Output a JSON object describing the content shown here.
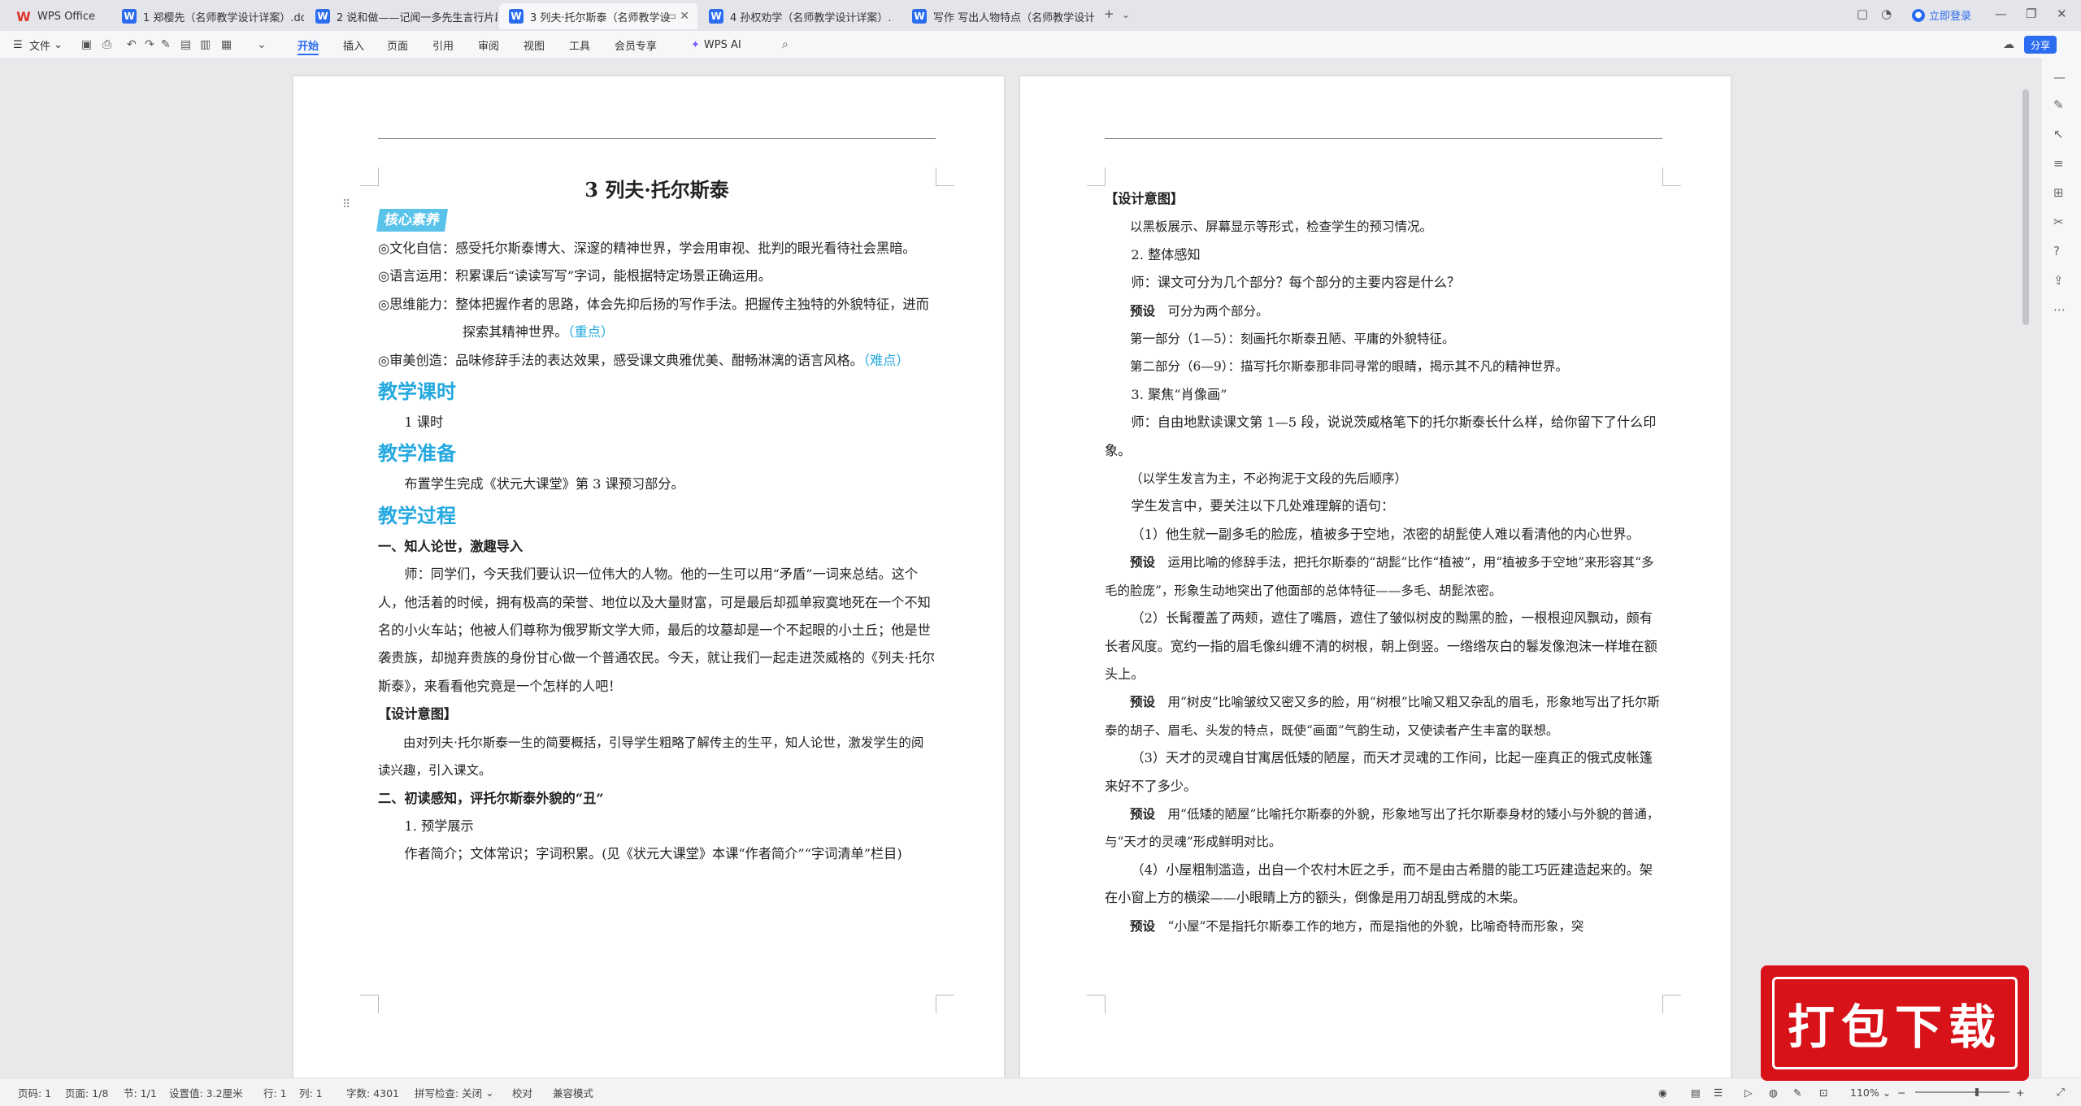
{
  "tabs": [
    {
      "label": "WPS Office",
      "kind": "wps"
    },
    {
      "label": "1 郑樱先（名师教学设计详案）.doc",
      "kind": "w"
    },
    {
      "label": "2 说和做——记闻一多先生言行片段",
      "kind": "w"
    },
    {
      "label": "3 列夫·托尔斯泰（名师教学设",
      "kind": "w",
      "active": true
    },
    {
      "label": "4 孙权劝学（名师教学设计详案）.d",
      "kind": "w"
    },
    {
      "label": "写作 写出人物特点（名师教学设计详",
      "kind": "w"
    }
  ],
  "topright": {
    "login": "立即登录"
  },
  "ribbon": {
    "file": "文件",
    "items": [
      "开始",
      "插入",
      "页面",
      "引用",
      "审阅",
      "视图",
      "工具",
      "会员专享"
    ],
    "ai": "WPS AI",
    "share": "分享"
  },
  "page1": {
    "title": "3  列夫·托尔斯泰",
    "badge": "核心素养",
    "lit": [
      {
        "label": "◎文化自信：",
        "text": "感受托尔斯泰博大、深邃的精神世界，学会用审视、批判的眼光看待社会黑暗。",
        "tag": ""
      },
      {
        "label": "◎语言运用：",
        "text": "积累课后“读读写写”字词，能根据特定场景正确运用。",
        "tag": ""
      },
      {
        "label": "◎思维能力：",
        "text": "整体把握作者的思路，体会先抑后扬的写作手法。把握传主独特的外貌特征，进而探索其精神世界。",
        "tag": "（重点）"
      },
      {
        "label": "◎审美创造：",
        "text": "品味修辞手法的表达效果，感受课文典雅优美、酣畅淋漓的语言风格。",
        "tag": "（难点）"
      }
    ],
    "sec1": "教学课时",
    "hours": "1 课时",
    "sec2": "教学准备",
    "prep": "布置学生完成《状元大课堂》第 3 课预习部分。",
    "sec3": "教学过程",
    "h1": "一、知人论世，激趣导入",
    "p1": "师：同学们，今天我们要认识一位伟大的人物。他的一生可以用“矛盾”一词来总结。这个人，他活着的时候，拥有极高的荣誉、地位以及大量财富，可是最后却孤单寂寞地死在一个不知名的小火车站；他被人们尊称为俄罗斯文学大师，最后的坟墓却是一个不起眼的小土丘；他是世袭贵族，却抛弃贵族的身份甘心做一个普通农民。今天，就让我们一起走进茨威格的《列夫·托尔斯泰》，来看看他究竟是一个怎样的人吧！",
    "design": "【设计意图】",
    "p2": "由对列夫·托尔斯泰一生的简要概括，引导学生粗略了解传主的生平，知人论世，激发学生的阅读兴趣，引入课文。",
    "h2": "二、初读感知，评托尔斯泰外貌的“丑”",
    "s1": "1. 预学展示",
    "p3": "作者简介；文体常识；字词积累。(见《状元大课堂》本课“作者简介”“字词清单”栏目)"
  },
  "page2": {
    "design": "【设计意图】",
    "q1": "以黑板展示、屏幕显示等形式，检查学生的预习情况。",
    "s2": "2. 整体感知",
    "q2": "师：课文可分为几个部分？每个部分的主要内容是什么？",
    "pre": "预设",
    "a2": "可分为两个部分。",
    "a2a": "第一部分（1—5）：刻画托尔斯泰丑陋、平庸的外貌特征。",
    "a2b": "第二部分（6—9）：描写托尔斯泰那非同寻常的眼睛，揭示其不凡的精神世界。",
    "s3": "3. 聚焦“肖像画”",
    "q3": "师：自由地默读课文第 1—5 段，说说茨威格笔下的托尔斯泰长什么样，给你留下了什么印象。",
    "q3n": "（以学生发言为主，不必拘泥于文段的先后顺序）",
    "q3m": "学生发言中，要关注以下几处难理解的语句：",
    "e1": "（1）他生就一副多毛的脸庞，植被多于空地，浓密的胡髭使人难以看清他的内心世界。",
    "r1": "运用比喻的修辞手法，把托尔斯泰的“胡髭”比作“植被”，用“植被多于空地”来形容其“多毛的脸庞”，形象生动地突出了他面部的总体特征——多毛、胡髭浓密。",
    "e2": "（2）长髯覆盖了两颊，遮住了嘴唇，遮住了皱似树皮的黝黑的脸，一根根迎风飘动，颇有长者风度。宽约一指的眉毛像纠缠不清的树根，朝上倒竖。一绺绺灰白的鬈发像泡沫一样堆在额头上。",
    "r2": "用“树皮”比喻皱纹又密又多的脸，用“树根”比喻又粗又杂乱的眉毛，形象地写出了托尔斯泰的胡子、眉毛、头发的特点，既使“画面”气韵生动，又使读者产生丰富的联想。",
    "e3": "（3）天才的灵魂自甘寓居低矮的陋屋，而天才灵魂的工作间，比起一座真正的俄式皮帐篷来好不了多少。",
    "r3": "用“低矮的陋屋”比喻托尔斯泰的外貌，形象地写出了托尔斯泰身材的矮小与外貌的普通，与“天才的灵魂”形成鲜明对比。",
    "e4": "（4）小屋粗制滥造，出自一个农村木匠之手，而不是由古希腊的能工巧匠建造起来的。架在小窗上方的横梁——小眼睛上方的额头，倒像是用刀胡乱劈成的木柴。",
    "r4": "“小屋”不是指托尔斯泰工作的地方，而是指他的外貌，比喻奇特而形象，突"
  },
  "status": {
    "page": "页码: 1",
    "pages": "页面: 1/8",
    "sec": "节: 1/1",
    "setval": "设置值: 3.2厘米",
    "row": "行: 1",
    "col": "列: 1",
    "words": "字数: 4301",
    "spell": "拼写检查: 关闭",
    "proof": "校对",
    "compat": "兼容模式",
    "zoom": "110%"
  },
  "download": "打包下载"
}
